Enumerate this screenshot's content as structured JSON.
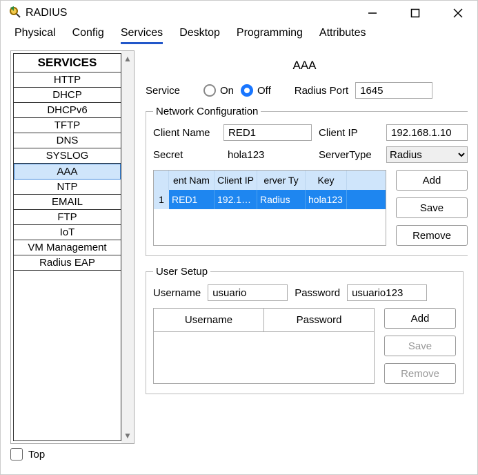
{
  "window": {
    "title": "RADIUS"
  },
  "tabs": {
    "t0": "Physical",
    "t1": "Config",
    "t2": "Services",
    "t3": "Desktop",
    "t4": "Programming",
    "t5": "Attributes"
  },
  "sidebar": {
    "header": "SERVICES",
    "items": [
      "HTTP",
      "DHCP",
      "DHCPv6",
      "TFTP",
      "DNS",
      "SYSLOG",
      "AAA",
      "NTP",
      "EMAIL",
      "FTP",
      "IoT",
      "VM Management",
      "Radius EAP"
    ]
  },
  "page": {
    "title": "AAA",
    "service_label": "Service",
    "on_label": "On",
    "off_label": "Off",
    "service_state": "Off",
    "port_label": "Radius Port",
    "port_value": "1645"
  },
  "network_config": {
    "legend": "Network Configuration",
    "client_name_label": "Client Name",
    "client_name_value": "RED1",
    "client_ip_label": "Client IP",
    "client_ip_value": "192.168.1.10",
    "secret_label": "Secret",
    "secret_value": "hola123",
    "server_type_label": "ServerType",
    "server_type_value": "Radius",
    "headers": {
      "c1": "ent Nam",
      "c2": "Client IP",
      "c3": "erver Ty",
      "c4": "Key"
    },
    "rows": [
      {
        "num": "1",
        "client_name": "RED1",
        "client_ip": "192.1…",
        "server_type": "Radius",
        "key": "hola123"
      }
    ],
    "buttons": {
      "add": "Add",
      "save": "Save",
      "remove": "Remove"
    }
  },
  "user_setup": {
    "legend": "User Setup",
    "username_label": "Username",
    "username_value": "usuario",
    "password_label": "Password",
    "password_value": "usuario123",
    "headers": {
      "c1": "Username",
      "c2": "Password"
    },
    "buttons": {
      "add": "Add",
      "save": "Save",
      "remove": "Remove"
    }
  },
  "bottom": {
    "top_label": "Top"
  }
}
